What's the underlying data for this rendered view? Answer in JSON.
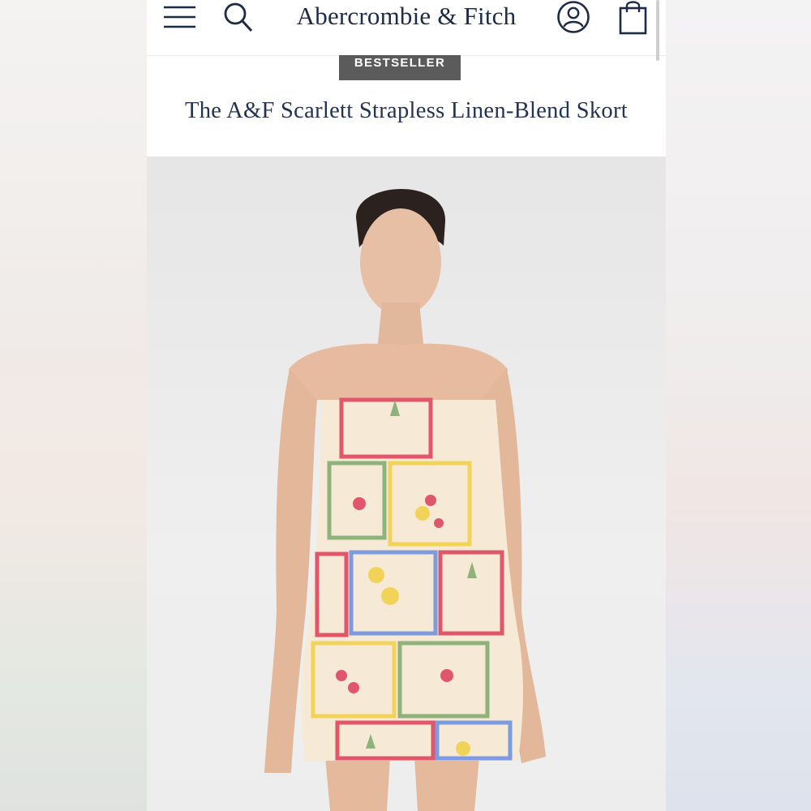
{
  "header": {
    "brand": "Abercrombie & Fitch",
    "menu_icon": "hamburger-menu-icon",
    "search_icon": "search-icon",
    "account_icon": "user-account-icon",
    "bag_icon": "shopping-bag-icon"
  },
  "product": {
    "badge": "BESTSELLER",
    "title": "The A&F Scarlett Strapless Linen-Blend Skort",
    "image_alt": "product-model-photo"
  },
  "colors": {
    "brand_navy": "#1d2b44",
    "badge_bg": "#5b5b5b",
    "print_red": "#e0566a",
    "print_blue": "#7f9be0",
    "print_yellow": "#f2d35a",
    "print_green": "#8fb27a"
  }
}
